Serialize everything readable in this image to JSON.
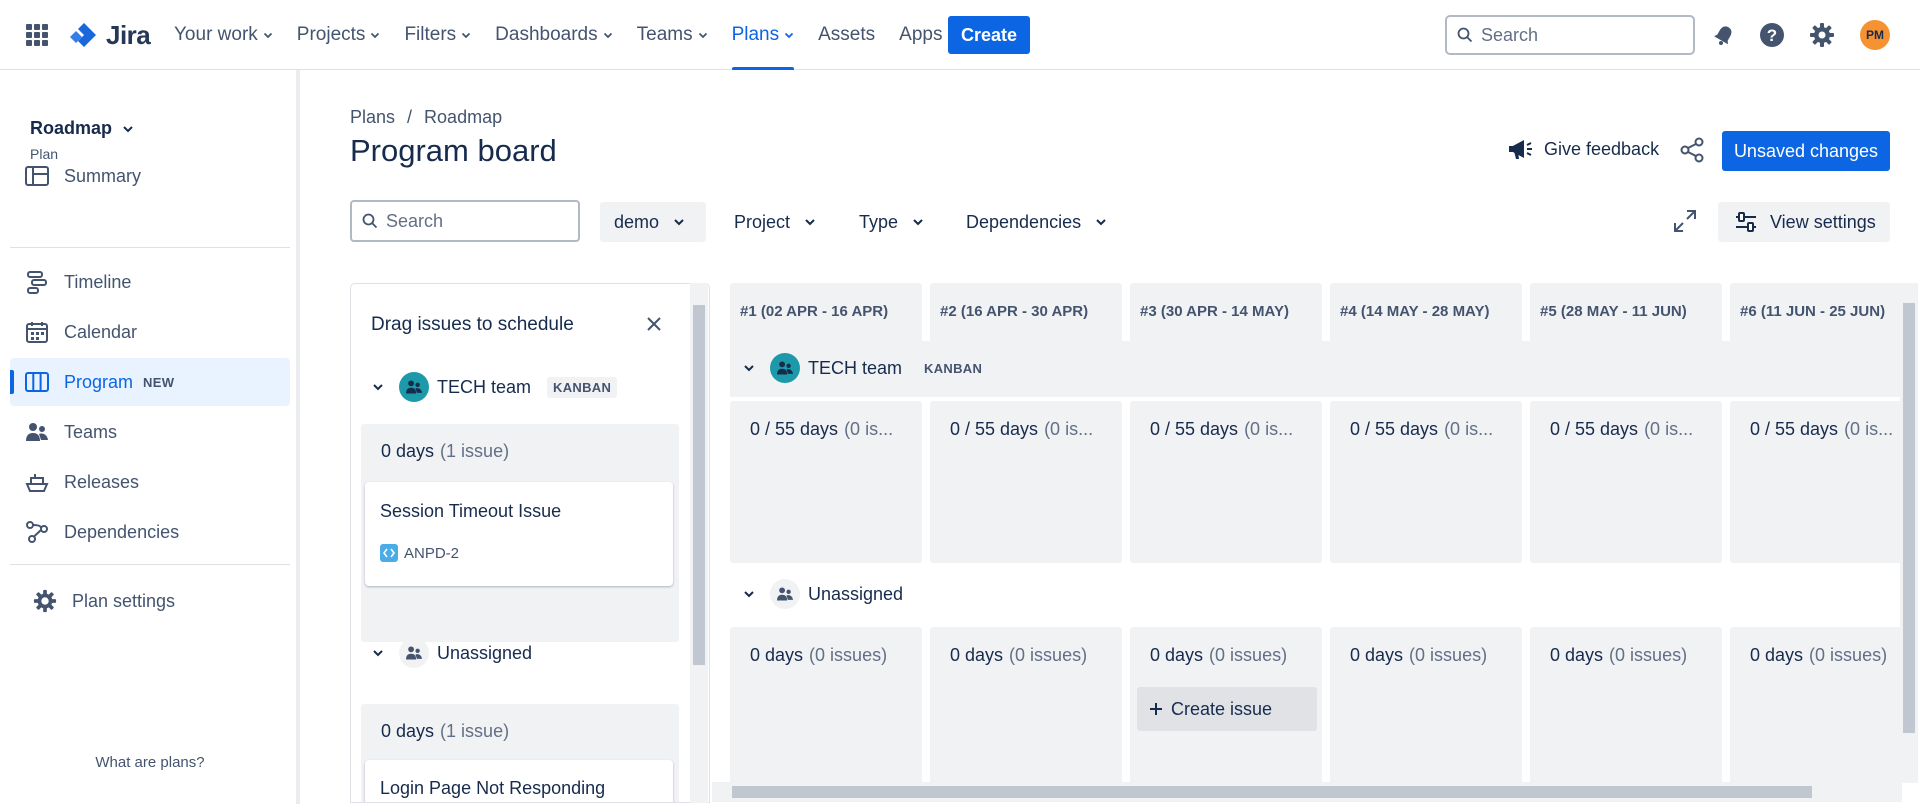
{
  "topnav": {
    "logo": "Jira",
    "items": [
      {
        "label": "Your work",
        "chevron": true,
        "active": false
      },
      {
        "label": "Projects",
        "chevron": true,
        "active": false
      },
      {
        "label": "Filters",
        "chevron": true,
        "active": false
      },
      {
        "label": "Dashboards",
        "chevron": true,
        "active": false
      },
      {
        "label": "Teams",
        "chevron": true,
        "active": false
      },
      {
        "label": "Plans",
        "chevron": true,
        "active": true
      },
      {
        "label": "Assets",
        "chevron": false,
        "active": false
      },
      {
        "label": "Apps",
        "chevron": true,
        "active": false
      }
    ],
    "create_label": "Create",
    "search_placeholder": "Search",
    "avatar_initials": "PM",
    "accent": "#0c66e4"
  },
  "sidebar": {
    "project_name": "Roadmap",
    "project_type": "Plan",
    "items": [
      {
        "label": "Summary",
        "icon": "summary-icon"
      },
      {
        "label": "Timeline",
        "icon": "timeline-icon"
      },
      {
        "label": "Calendar",
        "icon": "calendar-icon"
      },
      {
        "label": "Program",
        "icon": "program-icon",
        "badge": "NEW",
        "active": true
      },
      {
        "label": "Teams",
        "icon": "teams-icon"
      },
      {
        "label": "Releases",
        "icon": "releases-icon"
      },
      {
        "label": "Dependencies",
        "icon": "dependencies-icon"
      }
    ],
    "settings_label": "Plan settings",
    "footer": "What are plans?"
  },
  "header": {
    "breadcrumb": [
      "Plans",
      "Roadmap"
    ],
    "title": "Program board",
    "feedback_label": "Give feedback",
    "unsaved_label": "Unsaved changes"
  },
  "filters": {
    "search_placeholder": "Search",
    "items": [
      "demo",
      "Project",
      "Type",
      "Dependencies"
    ],
    "view_settings_label": "View settings"
  },
  "drag_panel": {
    "title": "Drag issues to schedule",
    "groups": [
      {
        "team": "TECH team",
        "badge": "KANBAN",
        "summary_days": "0 days",
        "summary_count": "(1 issue)",
        "issue": {
          "title": "Session Timeout Issue",
          "key": "ANPD-2"
        }
      },
      {
        "team": "Unassigned",
        "summary_days": "0 days",
        "summary_count": "(1 issue)",
        "issue": {
          "title": "Login Page Not Responding"
        }
      }
    ]
  },
  "board": {
    "sprints": [
      "#1 (02 APR - 16 APR)",
      "#2 (16 APR - 30 APR)",
      "#3 (30 APR - 14 MAY)",
      "#4 (14 MAY - 28 MAY)",
      "#5 (28 MAY - 11 JUN)",
      "#6 (11 JUN - 25 JUN)"
    ],
    "tech_team": {
      "name": "TECH team",
      "badge": "KANBAN",
      "capacity": "0 / 55 days",
      "count": "(0 is..."
    },
    "unassigned": {
      "name": "Unassigned",
      "days": "0 days",
      "count": "(0 issues)"
    },
    "create_issue_label": "Create issue"
  }
}
